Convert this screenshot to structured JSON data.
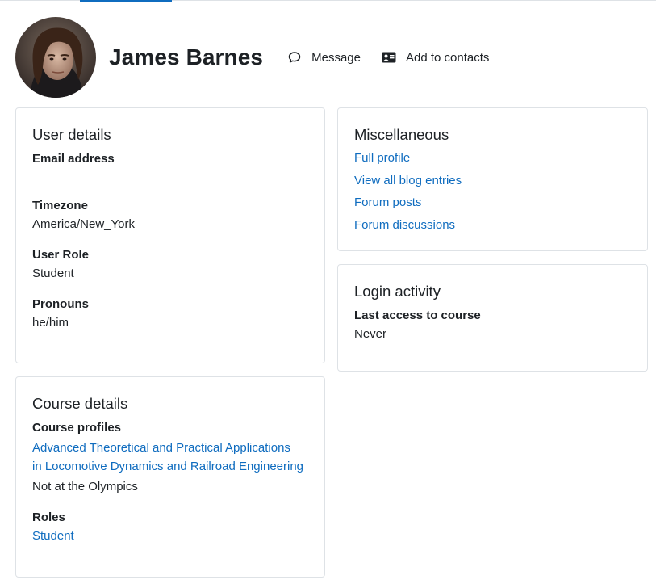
{
  "header": {
    "user_name": "James Barnes",
    "message_label": "Message",
    "add_contacts_label": "Add to contacts"
  },
  "user_details": {
    "title": "User details",
    "email_label": "Email address",
    "email_value": "",
    "timezone_label": "Timezone",
    "timezone_value": "America/New_York",
    "role_label": "User Role",
    "role_value": "Student",
    "pronouns_label": "Pronouns",
    "pronouns_value": "he/him"
  },
  "course_details": {
    "title": "Course details",
    "profiles_label": "Course profiles",
    "course_link_line1": "Advanced Theoretical and Practical Applications",
    "course_link_line2": "in Locomotive Dynamics and Railroad Engineering",
    "course_note": "Not at the Olympics",
    "roles_label": "Roles",
    "roles_value": "Student"
  },
  "miscellaneous": {
    "title": "Miscellaneous",
    "links": [
      "Full profile",
      "View all blog entries",
      "Forum posts",
      "Forum discussions"
    ]
  },
  "login_activity": {
    "title": "Login activity",
    "last_access_label": "Last access to course",
    "last_access_value": "Never"
  },
  "colors": {
    "link": "#0f6cbf",
    "text": "#1d2125",
    "border": "#dee2e6"
  }
}
